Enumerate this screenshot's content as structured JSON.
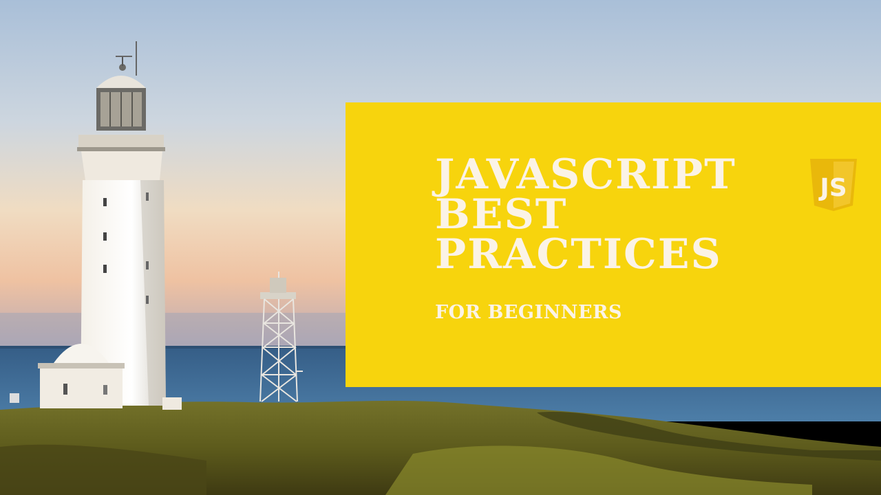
{
  "banner": {
    "title_lines": [
      "JAVASCRIPT",
      "BEST",
      "PRACTICES"
    ],
    "subtitle": "FOR BEGINNERS",
    "logo_text": "JS",
    "logo_icon": "javascript-shield-icon"
  },
  "colors": {
    "banner": "#f7d40d",
    "text": "#fbf3e6",
    "sky_top": "#aec2d8",
    "sky_horizon": "#f0c7a5",
    "sea": "#3f6f9a",
    "grass": "#6b6a1f"
  }
}
